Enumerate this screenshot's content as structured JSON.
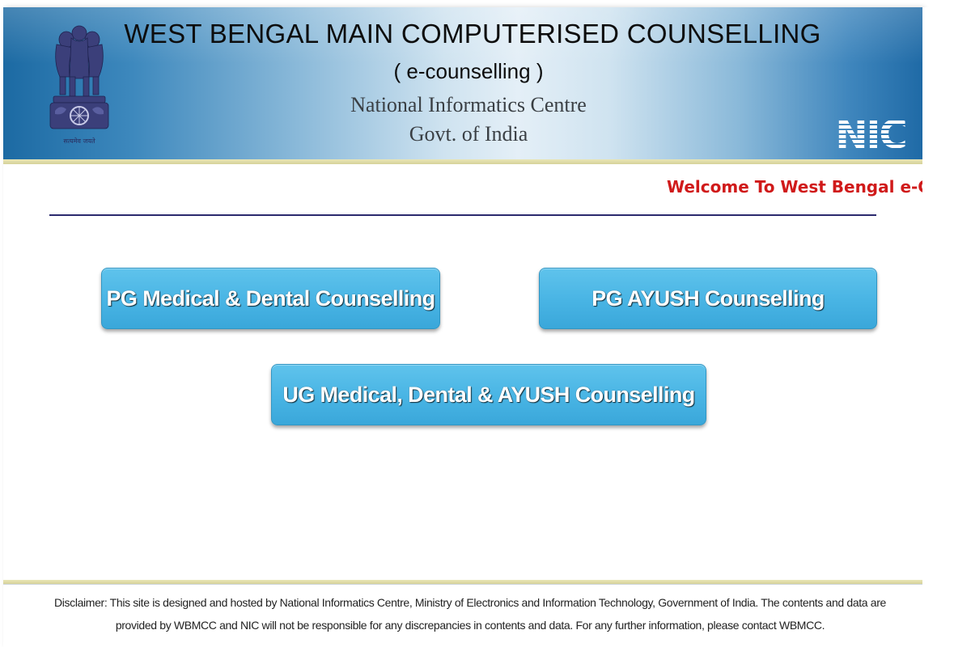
{
  "header": {
    "title": "WEST BENGAL MAIN COMPUTERISED COUNSELLING",
    "subtitle": "( e-counselling )",
    "org_name": "National Informatics Centre",
    "org_govt": "Govt. of India",
    "emblem_icon": "ashoka-emblem-icon",
    "emblem_motto": "सत्यमेव जयते",
    "nic_logo_text": "NIC"
  },
  "welcome_text": "Welcome To West Bengal e-Counselling",
  "buttons": {
    "pg_medical": "PG Medical & Dental Counselling",
    "pg_ayush": "PG AYUSH Counselling",
    "ug": "UG Medical, Dental & AYUSH Counselling"
  },
  "footer": {
    "line1": "Disclaimer: This site is designed and hosted by National Informatics Centre, Ministry of Electronics and Information Technology, Government of India. The contents and data are",
    "line2": "provided by WBMCC and NIC will not be responsible for any discrepancies in contents and data. For any further information, please contact WBMCC."
  },
  "colors": {
    "button_blue": "#48b4e4",
    "welcome_red": "#d01a1a",
    "rule_navy": "#2b2a6e",
    "banner_blue": "#1c6aa3"
  }
}
